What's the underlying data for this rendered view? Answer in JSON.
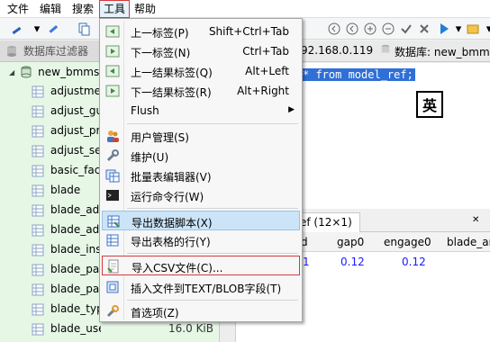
{
  "menubar": {
    "items": [
      "文件",
      "编辑",
      "搜索",
      "工具",
      "帮助"
    ]
  },
  "left_panel": {
    "filter_label": "数据库过滤器",
    "root_db": "new_bmms",
    "tables": [
      {
        "name": "adjustme",
        "size": ""
      },
      {
        "name": "adjust_gu",
        "size": ""
      },
      {
        "name": "adjust_pr",
        "size": ""
      },
      {
        "name": "adjust_se",
        "size": ""
      },
      {
        "name": "basic_fac",
        "size": ""
      },
      {
        "name": "blade",
        "size": ""
      },
      {
        "name": "blade_adj",
        "size": ""
      },
      {
        "name": "blade_adj",
        "size": ""
      },
      {
        "name": "blade_ins",
        "size": ""
      },
      {
        "name": "blade_pa",
        "size": ""
      },
      {
        "name": "blade_pa",
        "size": ""
      },
      {
        "name": "blade_typ",
        "size": ""
      },
      {
        "name": "blade_use",
        "size": "16.0 KiB"
      }
    ]
  },
  "hostbar": {
    "host": "92.168.0.119",
    "database": "数据库: new_bmms"
  },
  "editor": {
    "code": "* from model_ref;"
  },
  "ime_indicator": "英",
  "result_tab": "ef (12×1)",
  "grid": {
    "columns": [
      "d",
      "gap0",
      "engage0",
      "blade_ang"
    ],
    "row": [
      "1",
      "0.12",
      "0.12",
      ""
    ]
  },
  "tools_menu": {
    "items": [
      {
        "label": "上一标签(P)",
        "shortcut": "Shift+Ctrl+Tab",
        "icon": "prev-tab-icon"
      },
      {
        "label": "下一标签(N)",
        "shortcut": "Ctrl+Tab",
        "icon": "next-tab-icon"
      },
      {
        "label": "上一结果标签(Q)",
        "shortcut": "Alt+Left",
        "icon": "prev-result-tab-icon"
      },
      {
        "label": "下一结果标签(R)",
        "shortcut": "Alt+Right",
        "icon": "next-result-tab-icon"
      },
      {
        "label": "Flush",
        "shortcut": "",
        "icon": ""
      },
      {
        "label": "用户管理(S)",
        "shortcut": "",
        "icon": "users-icon"
      },
      {
        "label": "维护(U)",
        "shortcut": "",
        "icon": "wrench-icon"
      },
      {
        "label": "批量表编辑器(V)",
        "shortcut": "",
        "icon": "table-editor-icon"
      },
      {
        "label": "运行命令行(W)",
        "shortcut": "",
        "icon": "terminal-icon"
      },
      {
        "label": "导出数据脚本(X)",
        "shortcut": "",
        "icon": "export-script-icon"
      },
      {
        "label": "导出表格的行(Y)",
        "shortcut": "",
        "icon": "export-rows-icon"
      },
      {
        "label": "导入CSV文件(C)...",
        "shortcut": "",
        "icon": "import-csv-icon"
      },
      {
        "label": "插入文件到TEXT/BLOB字段(T)",
        "shortcut": "",
        "icon": "insert-file-icon"
      },
      {
        "label": "首选项(Z)",
        "shortcut": "",
        "icon": "preferences-icon"
      }
    ]
  },
  "colors": {
    "left_panel_bg": "#e6f7e6",
    "highlight": "#cce4f7",
    "red_outline": "#d23b3b",
    "selection": "#2f6fd6"
  }
}
